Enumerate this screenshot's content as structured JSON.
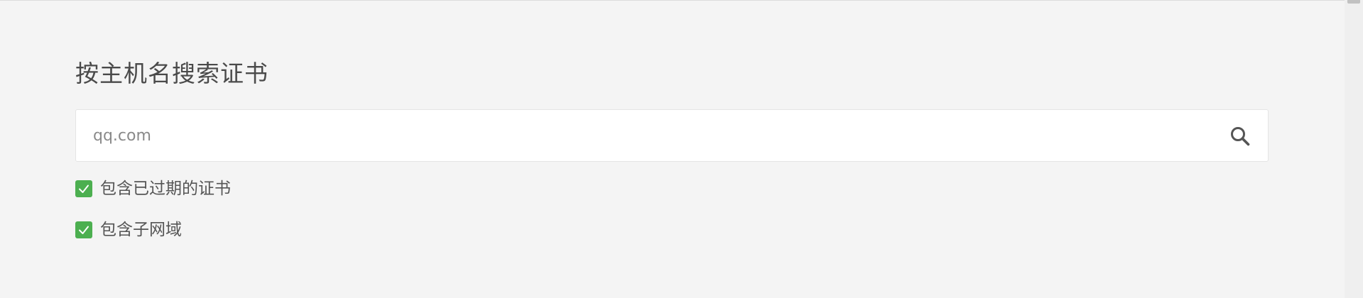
{
  "search_panel": {
    "title": "按主机名搜索证书",
    "search": {
      "value": "",
      "placeholder": "qq.com",
      "button_icon": "search-icon"
    },
    "options": [
      {
        "label": "包含已过期的证书",
        "checked": true,
        "icon": "check-icon"
      },
      {
        "label": "包含子网域",
        "checked": true,
        "icon": "check-icon"
      }
    ]
  },
  "colors": {
    "background": "#f4f4f4",
    "checkbox_checked": "#4caf50",
    "title_text": "#4a4a4a",
    "placeholder_text": "#8a8a8a"
  }
}
